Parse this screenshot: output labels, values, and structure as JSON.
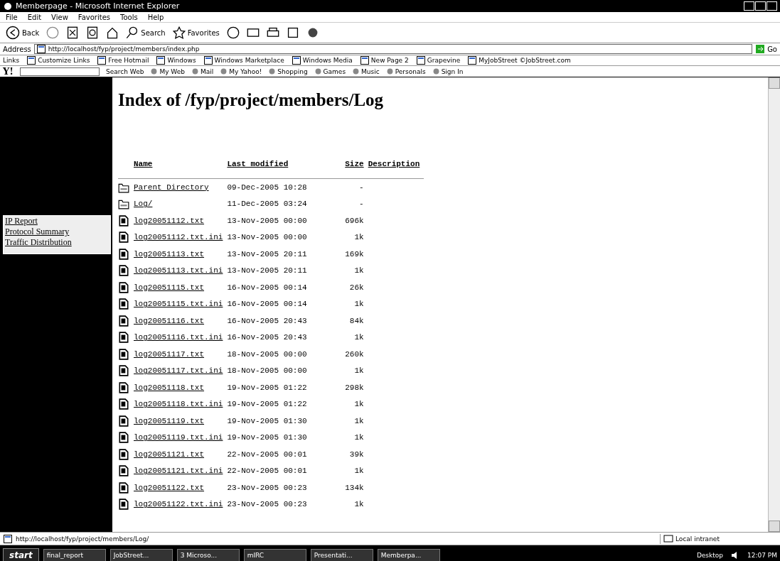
{
  "window": {
    "title": "Memberpage - Microsoft Internet Explorer"
  },
  "menu": [
    "File",
    "Edit",
    "View",
    "Favorites",
    "Tools",
    "Help"
  ],
  "toolbar": {
    "back": "Back",
    "search": "Search",
    "favorites": "Favorites"
  },
  "address": {
    "label": "Address",
    "value": "http://localhost/fyp/project/members/index.php",
    "go": "Go"
  },
  "links_bar": {
    "label": "Links",
    "items": [
      "Customize Links",
      "Free Hotmail",
      "Windows",
      "Windows Marketplace",
      "Windows Media",
      "New Page 2",
      "Grapevine",
      "MyJobStreet ©JobStreet.com"
    ]
  },
  "yahoo_bar": {
    "logo": "Y!",
    "search_button": "Search Web",
    "items": [
      "My Web",
      "Mail",
      "My Yahoo!",
      "Shopping",
      "Games",
      "Music",
      "Personals",
      "Sign In"
    ]
  },
  "sidebar": {
    "items": [
      "IP Report",
      "Protocol Summary",
      "Traffic Distribution"
    ]
  },
  "heading": "Index of /fyp/project/members/Log",
  "table": {
    "columns": [
      "Name",
      "Last modified",
      "Size",
      "Description"
    ],
    "rows": [
      {
        "kind": "folder",
        "name": "Parent Directory",
        "modified": "09-Dec-2005 10:28",
        "size": "-"
      },
      {
        "kind": "folder",
        "name": "Log/",
        "modified": "11-Dec-2005 03:24",
        "size": "-"
      },
      {
        "kind": "file",
        "name": "log20051112.txt",
        "modified": "13-Nov-2005 00:00",
        "size": "696k"
      },
      {
        "kind": "file",
        "name": "log20051112.txt.ini",
        "modified": "13-Nov-2005 00:00",
        "size": "1k"
      },
      {
        "kind": "file",
        "name": "log20051113.txt",
        "modified": "13-Nov-2005 20:11",
        "size": "169k"
      },
      {
        "kind": "file",
        "name": "log20051113.txt.ini",
        "modified": "13-Nov-2005 20:11",
        "size": "1k"
      },
      {
        "kind": "file",
        "name": "log20051115.txt",
        "modified": "16-Nov-2005 00:14",
        "size": "26k"
      },
      {
        "kind": "file",
        "name": "log20051115.txt.ini",
        "modified": "16-Nov-2005 00:14",
        "size": "1k"
      },
      {
        "kind": "file",
        "name": "log20051116.txt",
        "modified": "16-Nov-2005 20:43",
        "size": "84k"
      },
      {
        "kind": "file",
        "name": "log20051116.txt.ini",
        "modified": "16-Nov-2005 20:43",
        "size": "1k"
      },
      {
        "kind": "file",
        "name": "log20051117.txt",
        "modified": "18-Nov-2005 00:00",
        "size": "260k"
      },
      {
        "kind": "file",
        "name": "log20051117.txt.ini",
        "modified": "18-Nov-2005 00:00",
        "size": "1k"
      },
      {
        "kind": "file",
        "name": "log20051118.txt",
        "modified": "19-Nov-2005 01:22",
        "size": "298k"
      },
      {
        "kind": "file",
        "name": "log20051118.txt.ini",
        "modified": "19-Nov-2005 01:22",
        "size": "1k"
      },
      {
        "kind": "file",
        "name": "log20051119.txt",
        "modified": "19-Nov-2005 01:30",
        "size": "1k"
      },
      {
        "kind": "file",
        "name": "log20051119.txt.ini",
        "modified": "19-Nov-2005 01:30",
        "size": "1k"
      },
      {
        "kind": "file",
        "name": "log20051121.txt",
        "modified": "22-Nov-2005 00:01",
        "size": "39k"
      },
      {
        "kind": "file",
        "name": "log20051121.txt.ini",
        "modified": "22-Nov-2005 00:01",
        "size": "1k"
      },
      {
        "kind": "file",
        "name": "log20051122.txt",
        "modified": "23-Nov-2005 00:23",
        "size": "134k"
      },
      {
        "kind": "file",
        "name": "log20051122.txt.ini",
        "modified": "23-Nov-2005 00:23",
        "size": "1k"
      }
    ]
  },
  "status_bar": {
    "url": "http://localhost/fyp/project/members/Log/",
    "zone": "Local intranet"
  },
  "taskbar": {
    "start": "start",
    "tasks": [
      "final_report",
      "JobStreet...",
      "3 Microso...",
      "mIRC",
      "Presentati...",
      "Memberpa..."
    ],
    "desktop": "Desktop",
    "clock": "12:07 PM"
  }
}
